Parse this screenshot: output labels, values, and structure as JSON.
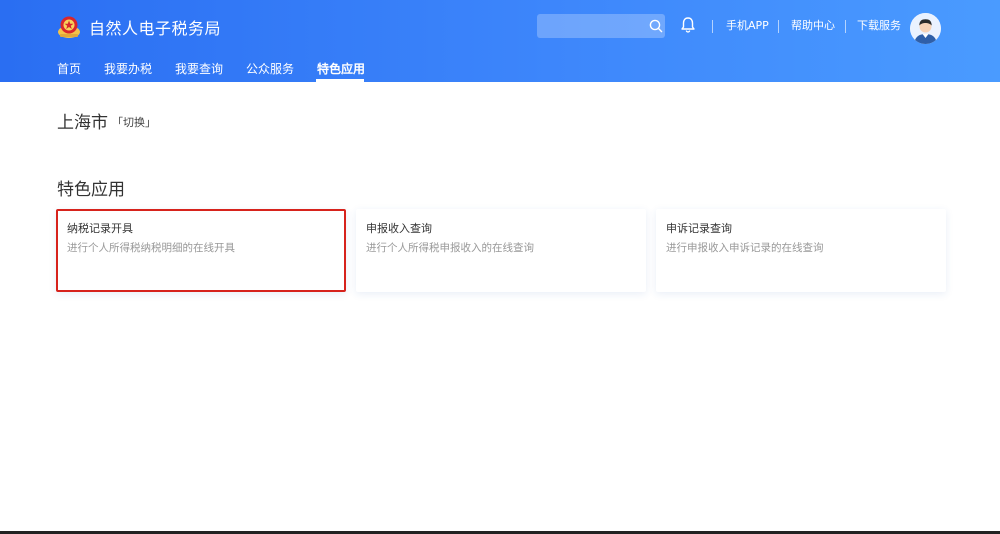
{
  "header": {
    "title": "自然人电子税务局",
    "search": {
      "placeholder": "",
      "value": ""
    },
    "links": [
      "手机APP",
      "帮助中心",
      "下载服务"
    ]
  },
  "nav": {
    "items": [
      {
        "label": "首页"
      },
      {
        "label": "我要办税"
      },
      {
        "label": "我要查询"
      },
      {
        "label": "公众服务"
      },
      {
        "label": "特色应用",
        "active": true
      }
    ]
  },
  "location": {
    "city": "上海市",
    "switch_label": "「切换」"
  },
  "section": {
    "title": "特色应用"
  },
  "cards": [
    {
      "title": "纳税记录开具",
      "desc": "进行个人所得税纳税明细的在线开具",
      "highlighted": true
    },
    {
      "title": "申报收入查询",
      "desc": "进行个人所得税申报收入的在线查询"
    },
    {
      "title": "申诉记录查询",
      "desc": "进行申报收入申诉记录的在线查询"
    }
  ],
  "colors": {
    "header_gradient_start": "#2a6ef2",
    "header_gradient_end": "#4a9bff",
    "highlight_border": "#d7231c",
    "muted_text": "#999999"
  },
  "icons": [
    "tax-emblem-icon",
    "search-icon",
    "bell-icon",
    "avatar"
  ]
}
